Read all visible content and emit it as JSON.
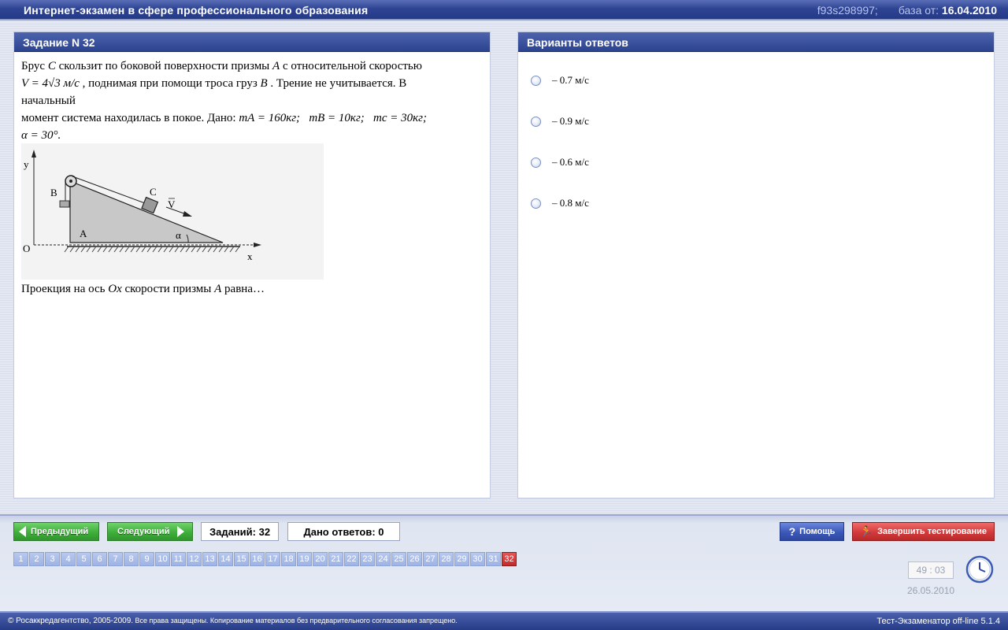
{
  "app": {
    "title": "Интернет-экзамен в сфере профессионального образования",
    "session_id": "f93s298997;",
    "db_label": "база от:",
    "db_date": "16.04.2010"
  },
  "task": {
    "header": "Задание N 32",
    "line1_a": "Брус ",
    "var_C": "C",
    "line1_b": " скользит по боковой поверхности призмы ",
    "var_A": "A",
    "line1_c": " с относительной скоростью",
    "formula_V": "V = 4√3 м/с",
    "line2_b": " , поднимая при помощи троса груз ",
    "var_B": "B",
    "line2_c": " . Трение не учитывается. В",
    "line3": "начальный",
    "line4_a": "момент система находилась в покое. Дано: ",
    "mA": "mA = 160кг;",
    "mB": "mB = 10кг;",
    "mc": "mc = 30кг;",
    "alpha": "α = 30°.",
    "question_a": "Проекция на ось ",
    "var_Ox": "Ox",
    "question_b": " скорости призмы ",
    "var_A2": "A",
    "question_c": " равна…",
    "figure_labels": {
      "y": "y",
      "x": "x",
      "o": "O",
      "a": "A",
      "b": "B",
      "c": "C",
      "v": "V",
      "alpha": "α"
    }
  },
  "answers": {
    "header": "Варианты ответов",
    "options": [
      {
        "label": "– 0.7 м/с"
      },
      {
        "label": "– 0.9 м/с"
      },
      {
        "label": "– 0.6 м/с"
      },
      {
        "label": "– 0.8 м/с"
      }
    ]
  },
  "nav": {
    "prev_label": "Предыдущий",
    "next_label": "Следующий",
    "tasks_count": "Заданий: 32",
    "answers_given": "Дано ответов: 0",
    "help_label": "Помощь",
    "finish_label": "Завершить тестирование",
    "questions": [
      "1",
      "2",
      "3",
      "4",
      "5",
      "6",
      "7",
      "8",
      "9",
      "10",
      "11",
      "12",
      "13",
      "14",
      "15",
      "16",
      "17",
      "18",
      "19",
      "20",
      "21",
      "22",
      "23",
      "24",
      "25",
      "26",
      "27",
      "28",
      "29",
      "30",
      "31",
      "32"
    ],
    "current": "32"
  },
  "timer": {
    "value": "49 : 03",
    "date": "26.05.2010"
  },
  "footer": {
    "copyright": "© Росаккредагентство, 2005-2009.",
    "rights": " Все права защищены. Копирование материалов без предварительного согласования запрещено.",
    "version": "Тест-Экзаменатор off-line 5.1.4"
  },
  "colors": {
    "header_blue": "#2f4594",
    "green_button": "#3fae3b",
    "red_button": "#d33a3a",
    "nav_active": "#c32b2b"
  }
}
